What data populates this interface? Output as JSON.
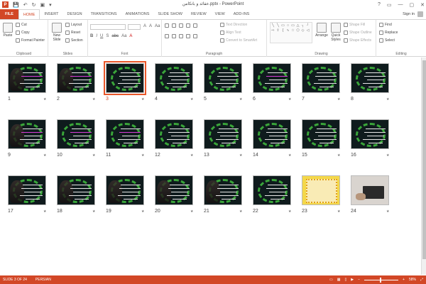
{
  "window": {
    "title": "عقائد و باتکامن.pptx - PowerPoint"
  },
  "qat": {
    "save": "💾",
    "undo": "↶",
    "redo": "↻",
    "present": "▣",
    "more": "▾"
  },
  "winctrls": {
    "help": "?",
    "ribbon": "▭",
    "min": "—",
    "max": "▢",
    "close": "✕"
  },
  "tabs": [
    "FILE",
    "HOME",
    "INSERT",
    "DESIGN",
    "TRANSITIONS",
    "ANIMATIONS",
    "SLIDE SHOW",
    "REVIEW",
    "VIEW",
    "ADD-INS"
  ],
  "active_tab": "HOME",
  "account": {
    "signin": "Sign in"
  },
  "ribbon": {
    "clipboard": {
      "paste": "Paste",
      "cut": "Cut",
      "copy": "Copy",
      "format_painter": "Format Painter",
      "label": "Clipboard"
    },
    "slides": {
      "new_slide": "New Slide",
      "layout": "Layout",
      "reset": "Reset",
      "section": "Section",
      "label": "Slides"
    },
    "font": {
      "label": "Font",
      "b": "B",
      "i": "I",
      "u": "U",
      "s": "S",
      "abc": "abc",
      "aa": "Aa",
      "a": "A"
    },
    "paragraph": {
      "text_direction": "Text Direction",
      "align_text": "Align Text",
      "convert_smartart": "Convert to SmartArt",
      "label": "Paragraph"
    },
    "drawing": {
      "arrange": "Arrange",
      "quick_styles": "Quick Styles",
      "shape_fill": "Shape Fill",
      "shape_outline": "Shape Outline",
      "shape_effects": "Shape Effects",
      "label": "Drawing"
    },
    "editing": {
      "find": "Find",
      "replace": "Replace",
      "select": "Select",
      "label": "Editing"
    }
  },
  "slides": [
    {
      "n": "1"
    },
    {
      "n": "2"
    },
    {
      "n": "3"
    },
    {
      "n": "4"
    },
    {
      "n": "5"
    },
    {
      "n": "6"
    },
    {
      "n": "7"
    },
    {
      "n": "8"
    },
    {
      "n": "9"
    },
    {
      "n": "10"
    },
    {
      "n": "11"
    },
    {
      "n": "12"
    },
    {
      "n": "13"
    },
    {
      "n": "14"
    },
    {
      "n": "15"
    },
    {
      "n": "16"
    },
    {
      "n": "17"
    },
    {
      "n": "18"
    },
    {
      "n": "19"
    },
    {
      "n": "20"
    },
    {
      "n": "21"
    },
    {
      "n": "22"
    },
    {
      "n": "23"
    },
    {
      "n": "24"
    }
  ],
  "selected_slide": "3",
  "star": "★",
  "status": {
    "slide_info": "SLIDE 3 OF 24",
    "language": "PERSIAN",
    "zoom": "58%",
    "minus": "−",
    "plus": "+"
  },
  "colors": {
    "accent": "#d24726",
    "selection": "#e8572a"
  }
}
